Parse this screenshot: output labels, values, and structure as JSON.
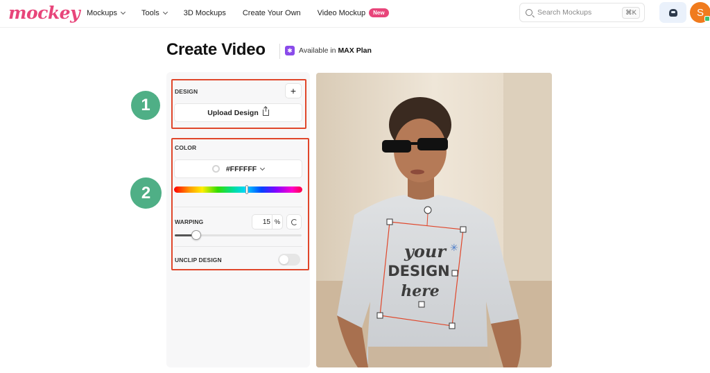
{
  "header": {
    "logo": "mockey",
    "nav": [
      {
        "label": "Mockups",
        "dropdown": true
      },
      {
        "label": "Tools",
        "dropdown": true
      },
      {
        "label": "3D Mockups",
        "dropdown": false
      },
      {
        "label": "Create Your Own",
        "dropdown": false
      },
      {
        "label": "Video Mockup",
        "dropdown": false,
        "badge": "New"
      }
    ],
    "search_placeholder": "Search Mockups",
    "search_shortcut": "⌘K",
    "support_icon": "support-agent-icon",
    "avatar_initial": "S"
  },
  "page": {
    "title": "Create Video",
    "plan_prefix": "Available in",
    "plan_name": "MAX Plan"
  },
  "panel": {
    "design": {
      "label": "DESIGN",
      "add": "+",
      "upload_label": "Upload Design"
    },
    "color": {
      "label": "COLOR",
      "value": "#FFFFFF",
      "hue_position": 0.57
    },
    "warping": {
      "label": "WARPING",
      "value": "15",
      "unit": "%",
      "fraction": 0.17
    },
    "unclip": {
      "label": "UNCLIP DESIGN",
      "enabled": false
    }
  },
  "steps": [
    "1",
    "2"
  ],
  "preview": {
    "design_text": {
      "line1": "your",
      "line2": "DESIGN",
      "line3": "here"
    }
  },
  "colors": {
    "brand": "#e8457a",
    "highlight": "#e0462a",
    "step": "#4faf86",
    "plan": "#8a4bea"
  }
}
